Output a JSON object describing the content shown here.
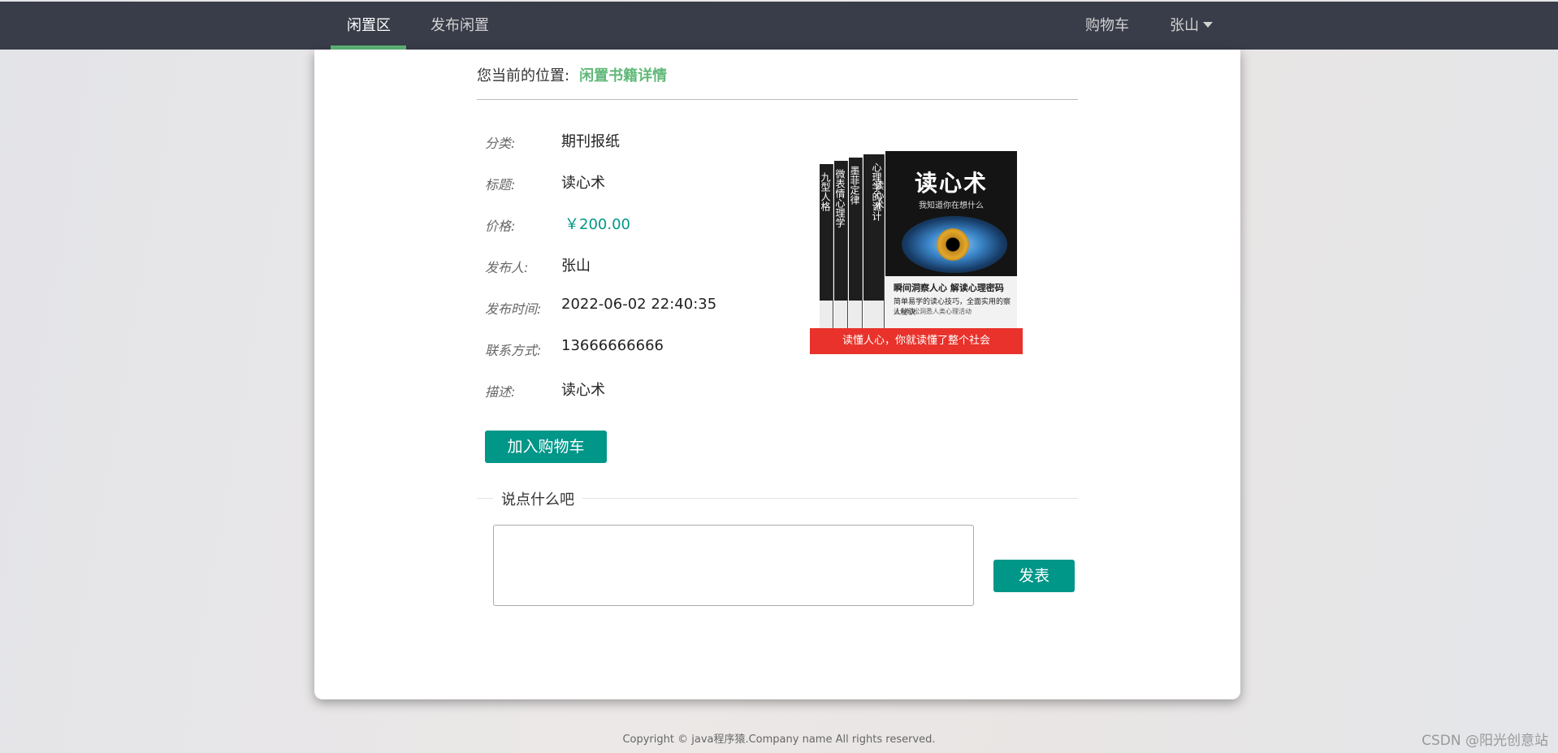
{
  "nav": {
    "left": [
      "闲置区",
      "发布闲置"
    ],
    "right": {
      "cart": "购物车",
      "user": "张山"
    }
  },
  "breadcrumb": {
    "label": "您当前的位置:",
    "current": "闲置书籍详情"
  },
  "details": {
    "category": {
      "label": "分类:",
      "value": "期刊报纸"
    },
    "title": {
      "label": "标题:",
      "value": "读心术"
    },
    "price": {
      "label": "价格:",
      "value": "￥200.00"
    },
    "publisher": {
      "label": "发布人:",
      "value": "张山"
    },
    "time": {
      "label": "发布时间:",
      "value": "2022-06-02 22:40:35"
    },
    "contact": {
      "label": "联系方式:",
      "value": "13666666666"
    },
    "description": {
      "label": "描述:",
      "value": "读心术"
    }
  },
  "cover": {
    "spines": [
      "九型人格",
      "微表情心理学",
      "墨菲定律",
      "心理学的诡计"
    ],
    "front_spine": "读心术",
    "front_title": "读心术",
    "front_subtitle": "我知道你在想什么",
    "front_line1": "瞬间洞察人心 解读心理密码",
    "front_line2": "简单易学的读心技巧，全面实用的察人秘诀",
    "front_line3": "让你轻松洞悉人类心理活动",
    "banner": "读懂人心，你就读懂了整个社会"
  },
  "actions": {
    "add_to_cart": "加入购物车",
    "post": "发表"
  },
  "comment": {
    "legend": "说点什么吧",
    "placeholder": ""
  },
  "footer": {
    "copyright": "Copyright © java程序猿.Company name All rights reserved.",
    "watermark": "CSDN @阳光创意站"
  },
  "colors": {
    "accent": "#009688",
    "nav_bg": "#393d49",
    "active_underline": "#5fb878",
    "banner": "#e8322b"
  }
}
